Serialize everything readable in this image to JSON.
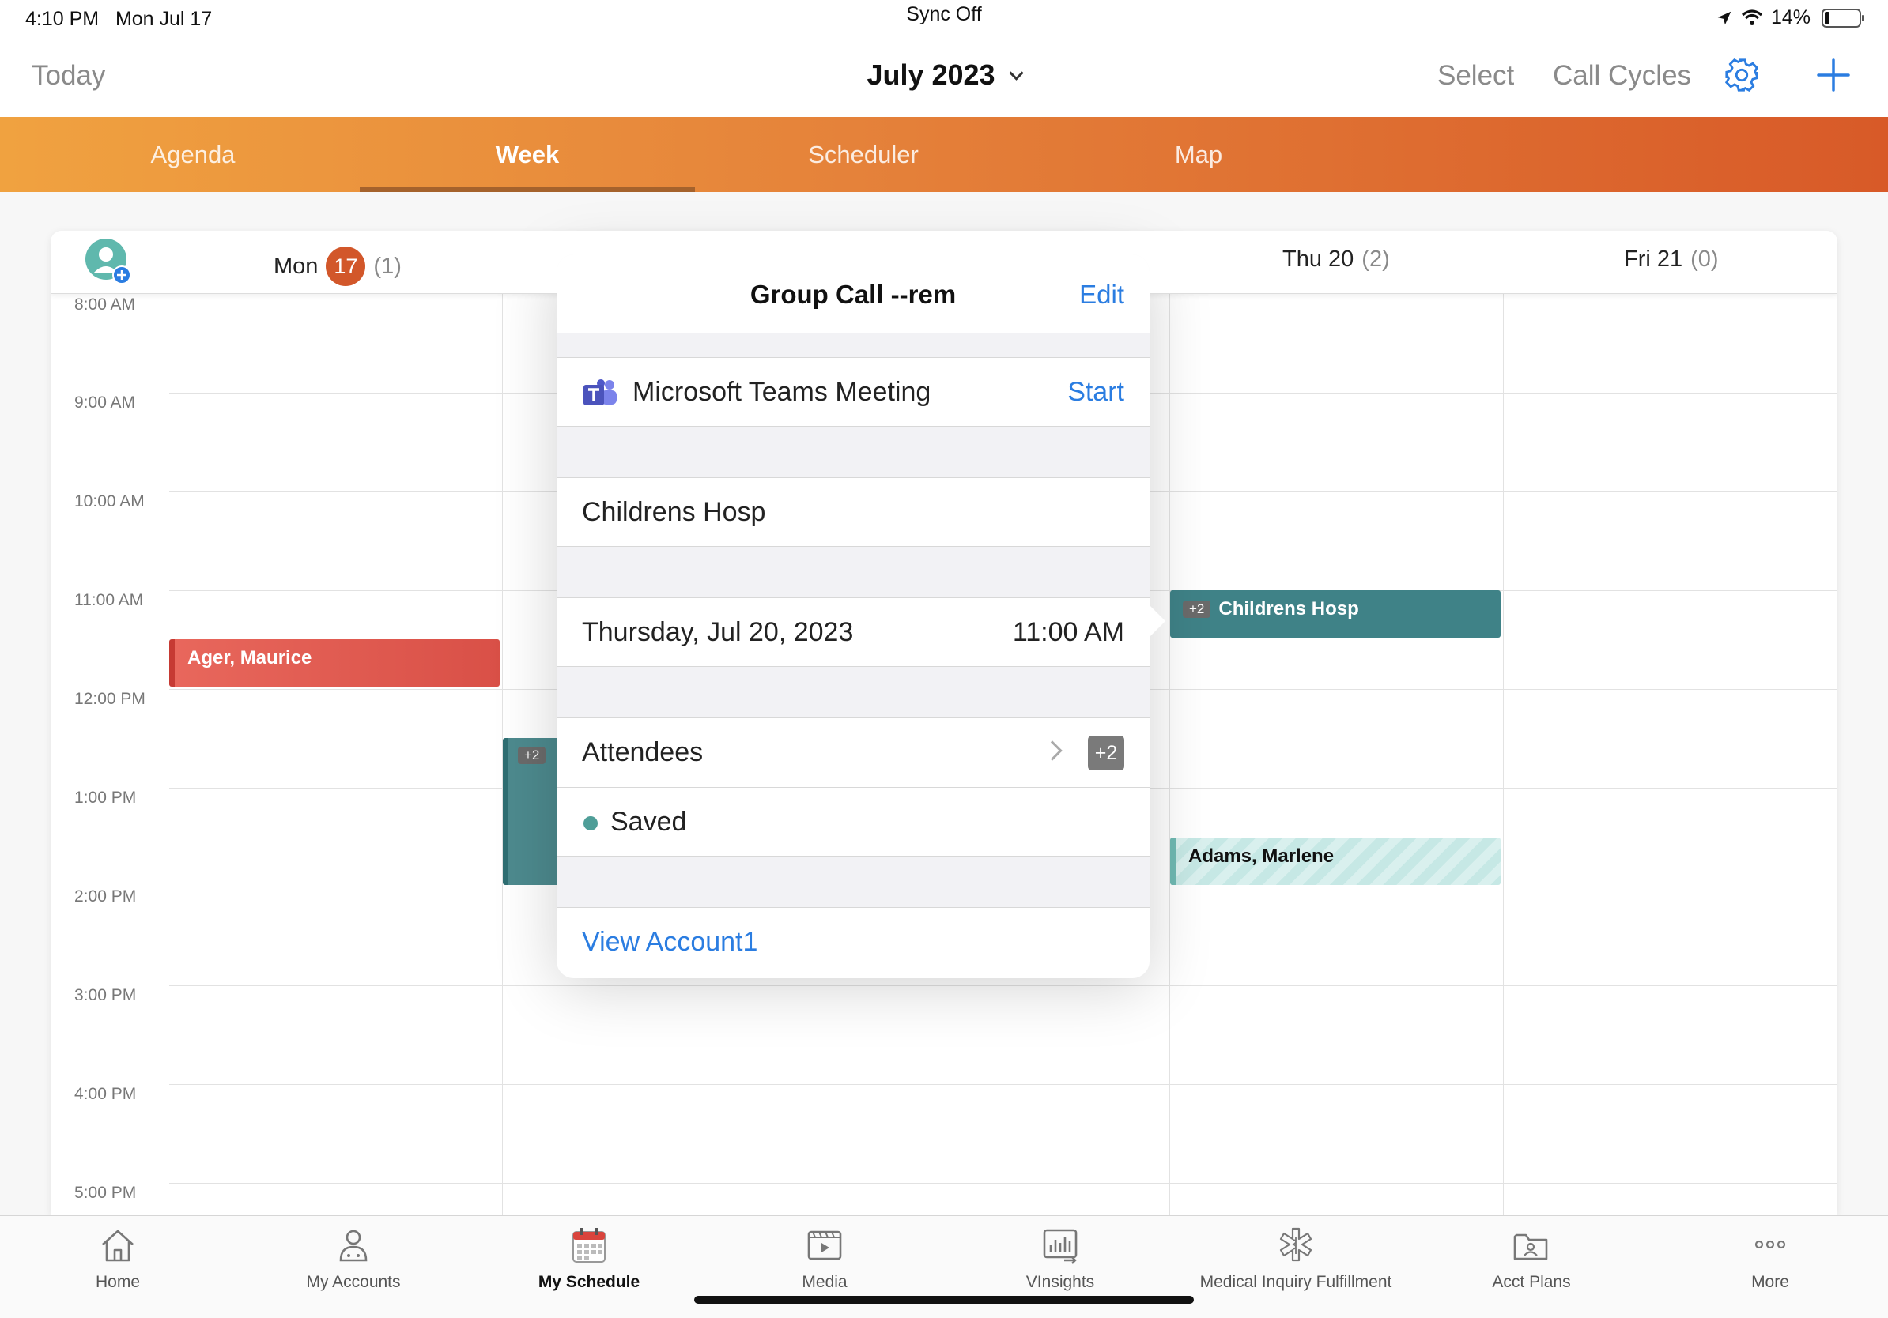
{
  "status_bar": {
    "time": "4:10 PM",
    "date": "Mon Jul 17",
    "sync": "Sync Off",
    "battery": "14%"
  },
  "nav": {
    "today": "Today",
    "month": "July 2023",
    "select": "Select",
    "call_cycles": "Call Cycles"
  },
  "tabs": [
    {
      "label": "Agenda",
      "active": false
    },
    {
      "label": "Week",
      "active": true
    },
    {
      "label": "Scheduler",
      "active": false
    },
    {
      "label": "Map",
      "active": false
    }
  ],
  "week": {
    "days": [
      {
        "label": "Mon",
        "badge": "17",
        "count": "(1)"
      },
      {
        "label": "Thu 20",
        "count": "(2)"
      },
      {
        "label": "Fri 21",
        "count": "(0)"
      }
    ],
    "hours": [
      "8:00 AM",
      "9:00 AM",
      "10:00 AM",
      "11:00 AM",
      "12:00 PM",
      "1:00 PM",
      "2:00 PM",
      "3:00 PM",
      "4:00 PM",
      "5:00 PM"
    ],
    "events": [
      {
        "title": "Ager, Maurice"
      },
      {
        "badge": "+2",
        "title": ""
      },
      {
        "badge": "+2",
        "title": "Childrens Hosp"
      },
      {
        "title": "Adams, Marlene"
      }
    ]
  },
  "popover": {
    "title": "Group Call --rem",
    "edit": "Edit",
    "meeting": "Microsoft Teams Meeting",
    "start": "Start",
    "location": "Childrens Hosp",
    "date": "Thursday, Jul 20, 2023",
    "time": "11:00 AM",
    "attendees": "Attendees",
    "attendees_badge": "+2",
    "status": "Saved",
    "view_account": "View Account1"
  },
  "bottom_tabs": [
    {
      "label": "Home",
      "icon": "home-icon"
    },
    {
      "label": "My Accounts",
      "icon": "accounts-icon"
    },
    {
      "label": "My Schedule",
      "icon": "calendar-icon",
      "active": true
    },
    {
      "label": "Media",
      "icon": "media-icon"
    },
    {
      "label": "VInsights",
      "icon": "insights-icon"
    },
    {
      "label": "Medical Inquiry Fulfillment",
      "icon": "medical-icon"
    },
    {
      "label": "Acct Plans",
      "icon": "acct-plans-icon"
    },
    {
      "label": "More",
      "icon": "more-icon"
    }
  ],
  "colors": {
    "accent_blue": "#2b7de1",
    "tab_gradient_start": "#f0a240",
    "tab_gradient_end": "#d85a28",
    "today_badge": "#d2572a",
    "event_red": "#e8675c",
    "event_teal": "#3f8287"
  }
}
